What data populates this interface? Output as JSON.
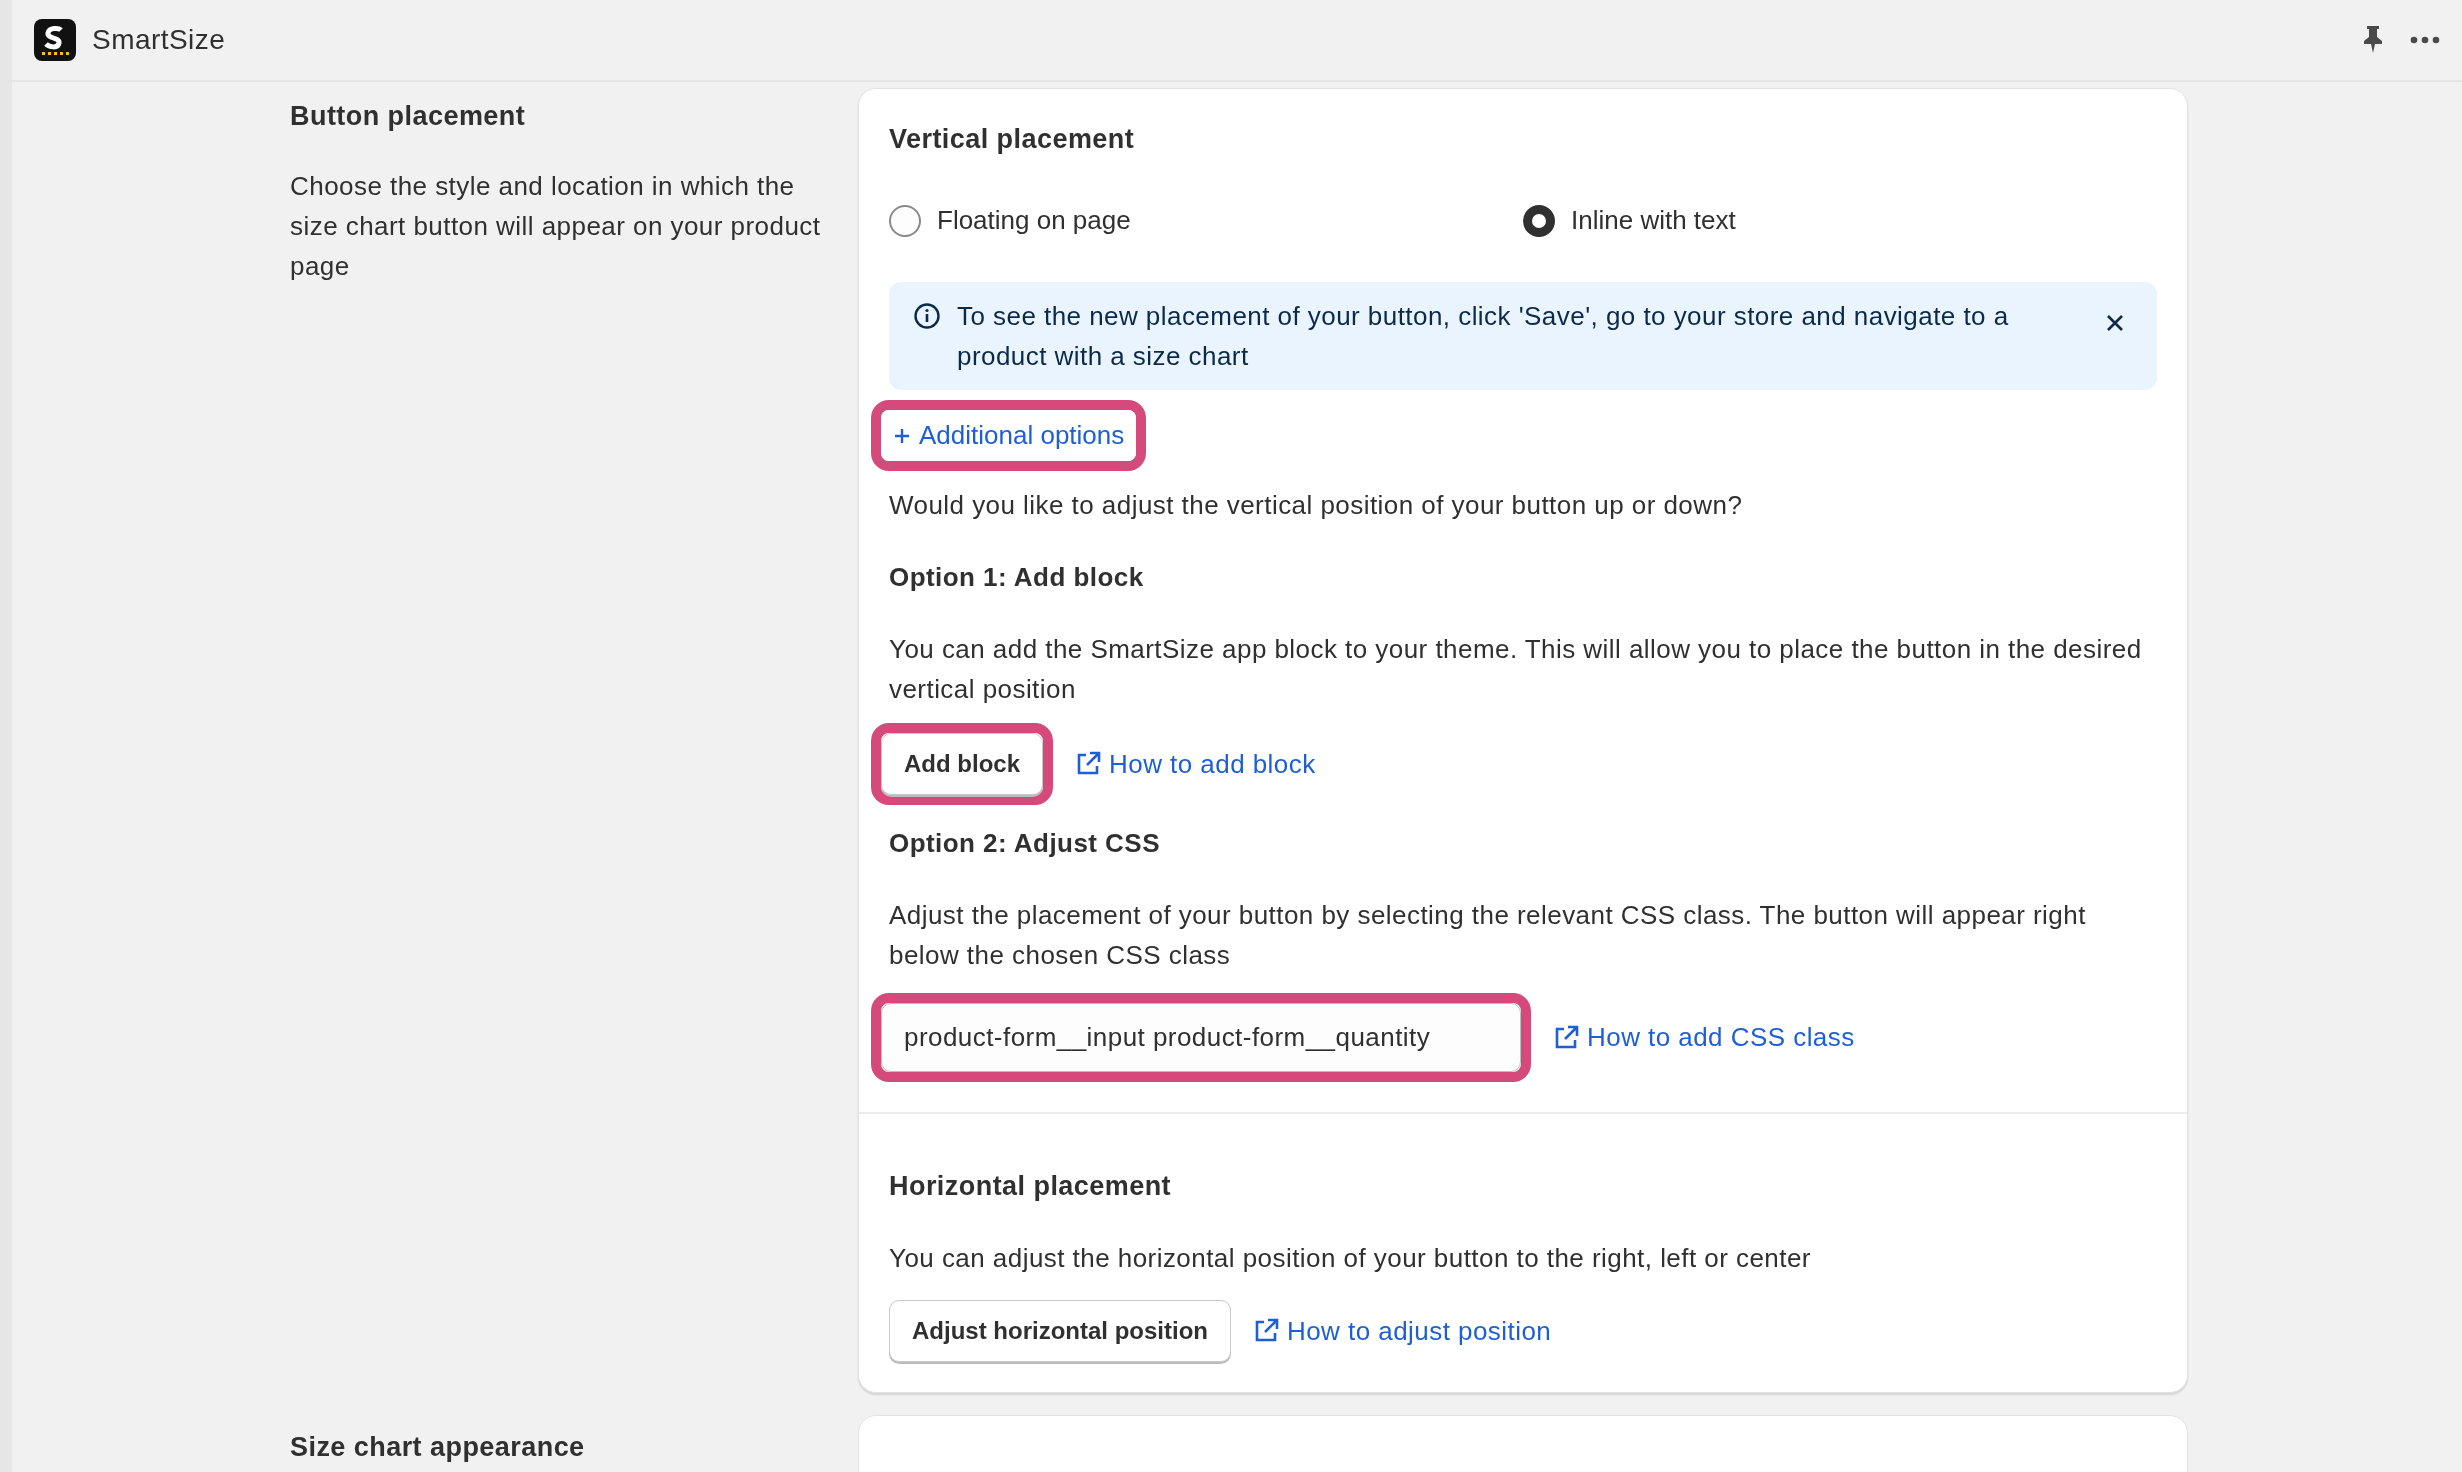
{
  "header": {
    "app_name": "SmartSize"
  },
  "button_placement": {
    "title": "Button placement",
    "description": "Choose the style and location in which the size chart button will appear on your product page"
  },
  "vertical_placement": {
    "title": "Vertical placement",
    "options": [
      {
        "label": "Floating on page",
        "selected": false
      },
      {
        "label": "Inline with text",
        "selected": true
      }
    ],
    "banner": {
      "text": "To see the new placement of your button, click 'Save', go to your store and navigate to a product with a size chart"
    },
    "additional_options": {
      "label": "Additional options",
      "highlighted": true
    },
    "question": "Would you like to adjust the vertical position of your button up or down?",
    "option_1": {
      "title": "Option 1: Add block",
      "text": "You can add the SmartSize app block to your theme. This will allow you to place the button in the desired vertical position",
      "button": {
        "label": "Add block",
        "highlighted": true
      },
      "link": "How to add block"
    },
    "option_2": {
      "title": "Option 2: Adjust CSS",
      "text": "Adjust the placement of your button by selecting the relevant CSS class. The button will appear right below the chosen CSS class",
      "field": {
        "value": "product-form__input product-form__quantity",
        "highlighted": true
      },
      "link": "How to add CSS class"
    }
  },
  "horizontal_placement": {
    "title": "Horizontal placement",
    "text": "You can adjust the horizontal position of your button to the right, left or center",
    "button": {
      "label": "Adjust horizontal position"
    },
    "link": "How to adjust position"
  },
  "size_chart_appearance": {
    "title": "Size chart appearance"
  }
}
